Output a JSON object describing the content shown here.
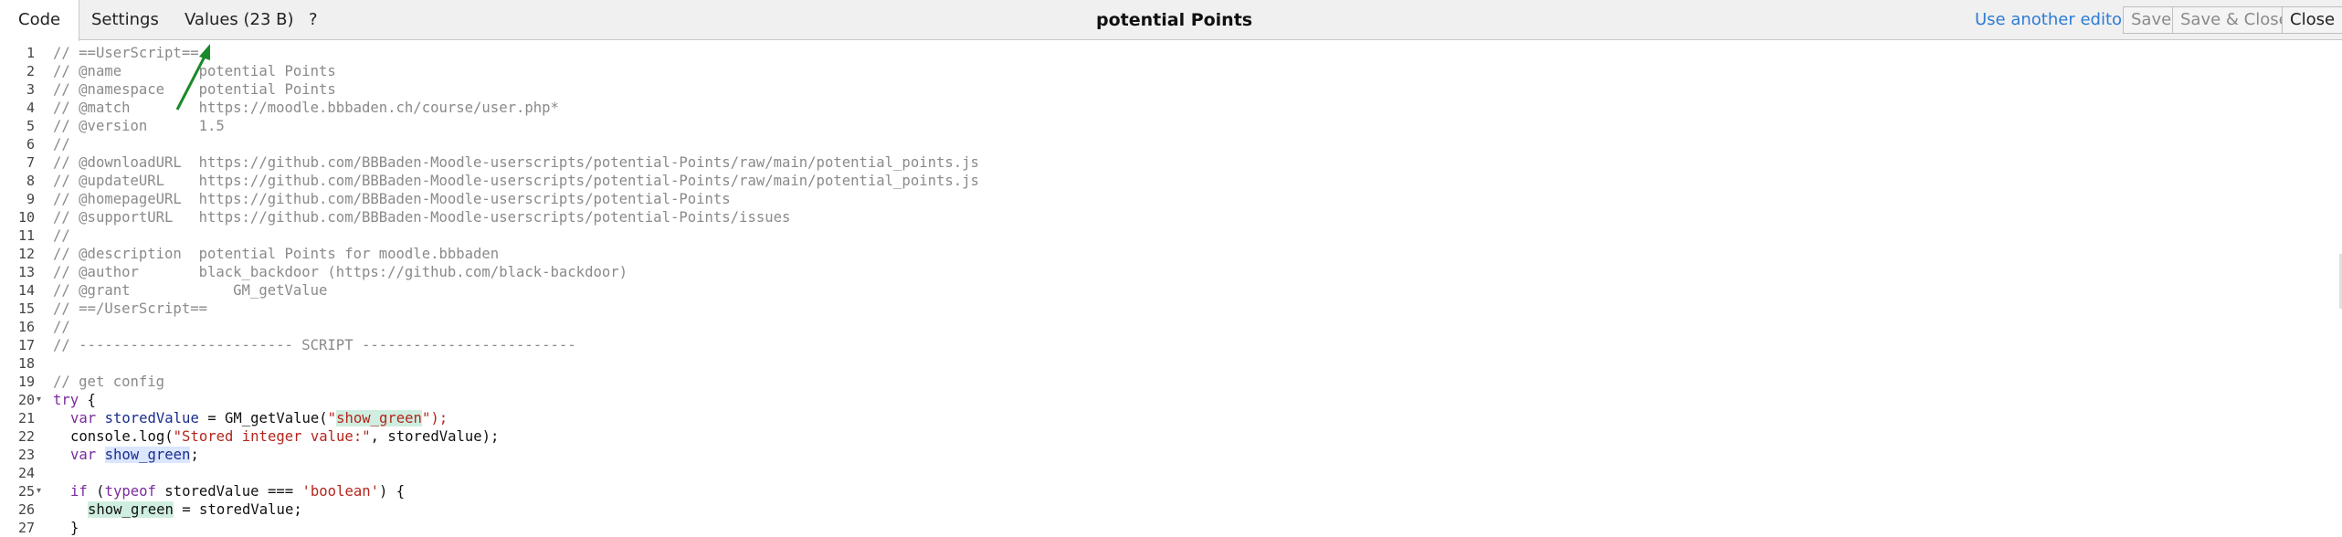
{
  "tabs": [
    {
      "label": "Code"
    },
    {
      "label": "Settings"
    },
    {
      "label": "Values (23 B)"
    },
    {
      "label": "?"
    }
  ],
  "title": "potential Points",
  "actions": {
    "another_editor": "Use another editor?",
    "save": "Save",
    "save_close": "Save & Close",
    "close": "Close"
  },
  "line_numbers": [
    "1",
    "2",
    "3",
    "4",
    "5",
    "6",
    "7",
    "8",
    "9",
    "10",
    "11",
    "12",
    "13",
    "14",
    "15",
    "16",
    "17",
    "18",
    "19",
    "20",
    "21",
    "22",
    "23",
    "24",
    "25",
    "26",
    "27"
  ],
  "code": {
    "l1": "// ==UserScript==",
    "l2": "// @name         potential Points",
    "l3": "// @namespace    potential Points",
    "l4": "// @match        https://moodle.bbbaden.ch/course/user.php*",
    "l5": "// @version      1.5",
    "l6": "//",
    "l7": "// @downloadURL  https://github.com/BBBaden-Moodle-userscripts/potential-Points/raw/main/potential_points.js",
    "l8": "// @updateURL    https://github.com/BBBaden-Moodle-userscripts/potential-Points/raw/main/potential_points.js",
    "l9": "// @homepageURL  https://github.com/BBBaden-Moodle-userscripts/potential-Points",
    "l10": "// @supportURL   https://github.com/BBBaden-Moodle-userscripts/potential-Points/issues",
    "l11": "//",
    "l12": "// @description  potential Points for moodle.bbbaden",
    "l13": "// @author       black_backdoor (https://github.com/black-backdoor)",
    "l14": "// @grant            GM_getValue",
    "l15": "// ==/UserScript==",
    "l16": "//",
    "l17": "// ------------------------- SCRIPT -------------------------",
    "l18": "",
    "l19": "// get config",
    "l20_kw": "try",
    "l20_rest": " {",
    "l21_kw": "var",
    "l21_var": "storedValue",
    "l21_mid": " = GM_getValue(",
    "l21_q1": "\"",
    "l21_str": "show_green",
    "l21_end": "\");",
    "l22_pre": "console.log(",
    "l22_str": "\"Stored integer value:\"",
    "l22_end": ", storedValue);",
    "l23_kw": "var",
    "l23_var": "show_green",
    "l23_end": ";",
    "l25_kw1": "if",
    "l25_a": " (",
    "l25_kw2": "typeof",
    "l25_b": " storedValue === ",
    "l25_str": "'boolean'",
    "l25_c": ") {",
    "l26_var": "show_green",
    "l26_end": " = storedValue;",
    "l27": "}"
  },
  "icons": {
    "fold": "fold-arrow-icon",
    "annotation": "green-arrow-icon"
  },
  "colors": {
    "link": "#2d7bd4",
    "annotation_arrow": "#1a8a2a"
  }
}
